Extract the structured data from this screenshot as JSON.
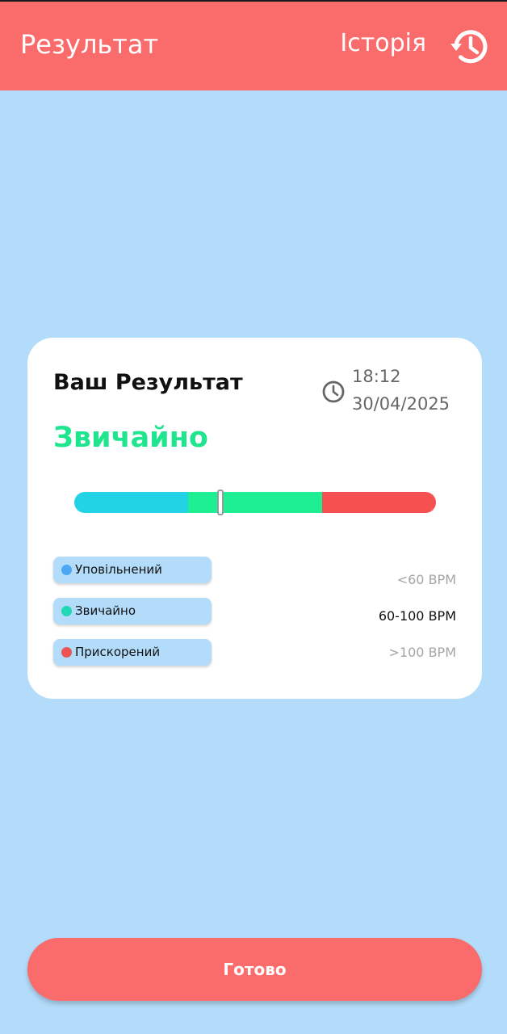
{
  "header": {
    "title": "Результат",
    "history_label": "Історія",
    "history_icon": "history-icon"
  },
  "result_card": {
    "title": "Ваш Результат",
    "time": "18:12",
    "date": "30/04/2025",
    "time_icon": "clock-icon",
    "status": "Звичайно",
    "status_color": "#1fe58f",
    "scale": {
      "segments": [
        {
          "name": "low",
          "color": "#22d3e6"
        },
        {
          "name": "normal",
          "color": "#1fef93"
        },
        {
          "name": "high",
          "color": "#f65050"
        }
      ],
      "marker_fraction": 0.405
    },
    "legend": [
      {
        "label": "Уповільнений",
        "range": "<60 BPM",
        "dot_color": "#4ea7f3",
        "range_color": "#a5a5a5"
      },
      {
        "label": "Звичайно",
        "range": "60-100 BPM",
        "dot_color": "#22d8b4",
        "range_color": "#111111"
      },
      {
        "label": "Прискорений",
        "range": ">100 BPM",
        "dot_color": "#ec5454",
        "range_color": "#a5a5a5"
      }
    ]
  },
  "footer": {
    "done_label": "Готово"
  },
  "colors": {
    "background": "#b3dcfa",
    "accent": "#fa6b6b"
  }
}
